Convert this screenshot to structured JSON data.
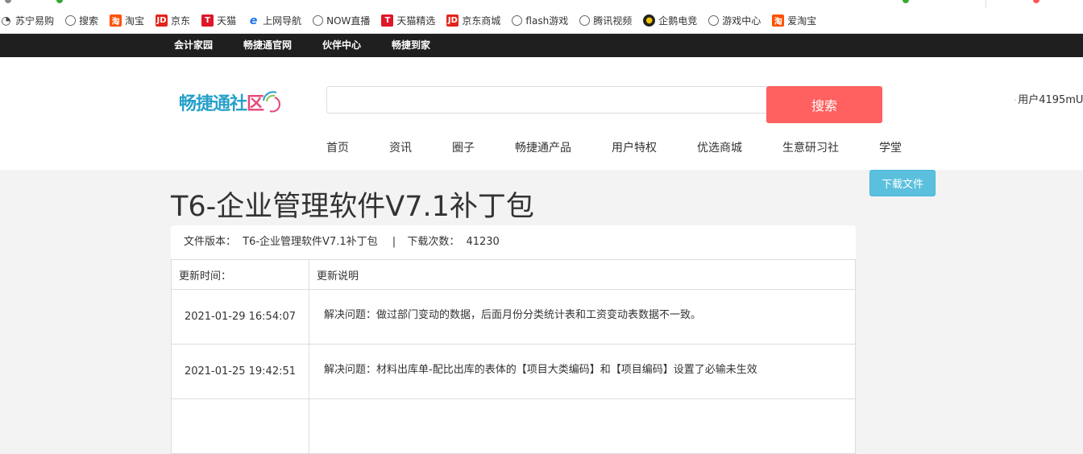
{
  "bookmarks": [
    {
      "label": "苏宁易购",
      "icon": "suning-icon"
    },
    {
      "label": "搜索",
      "icon": "globe-icon"
    },
    {
      "label": "淘宝",
      "icon": "taobao-icon"
    },
    {
      "label": "京东",
      "icon": "jd-icon"
    },
    {
      "label": "天猫",
      "icon": "tmall-icon"
    },
    {
      "label": "上网导航",
      "icon": "ie-icon"
    },
    {
      "label": "NOW直播",
      "icon": "globe-icon"
    },
    {
      "label": "天猫精选",
      "icon": "tmall-icon"
    },
    {
      "label": "京东商城",
      "icon": "jd-icon"
    },
    {
      "label": "flash游戏",
      "icon": "globe-icon"
    },
    {
      "label": "腾讯视频",
      "icon": "globe-icon"
    },
    {
      "label": "企鹅电竞",
      "icon": "game-icon"
    },
    {
      "label": "游戏中心",
      "icon": "globe-icon"
    },
    {
      "label": "爱淘宝",
      "icon": "taobao-icon"
    }
  ],
  "sitebar": [
    "会计家园",
    "畅捷通官网",
    "伙伴中心",
    "畅捷到家"
  ],
  "logo": {
    "text_main": "畅捷通社",
    "text_accent": "区"
  },
  "search": {
    "value": "",
    "button": "搜索"
  },
  "user": "用户4195mU",
  "nav": [
    "首页",
    "资讯",
    "圈子",
    "畅捷通产品",
    "用户特权",
    "优选商城",
    "生意研习社",
    "学堂"
  ],
  "download_button": "下载文件",
  "page_title": "T6-企业管理软件V7.1补丁包",
  "info": {
    "version_label": "文件版本：",
    "version_value": "T6-企业管理软件V7.1补丁包",
    "sep": "|",
    "downloads_label": "下载次数：",
    "downloads_value": "41230"
  },
  "table": {
    "headers": [
      "更新时间：",
      "更新说明"
    ],
    "rows": [
      {
        "time": "2021-01-29 16:54:07",
        "desc": "解决问题：做过部门变动的数据，后面月份分类统计表和工资变动表数据不一致。"
      },
      {
        "time": "2021-01-25 19:42:51",
        "desc": "解决问题：材料出库单-配比出库的表体的【项目大类编码】和【项目编码】设置了必输未生效"
      }
    ]
  },
  "colors": {
    "search_button": "#ff6060",
    "download_button": "#5bc0de",
    "sitebar": "#1f1f1f"
  }
}
